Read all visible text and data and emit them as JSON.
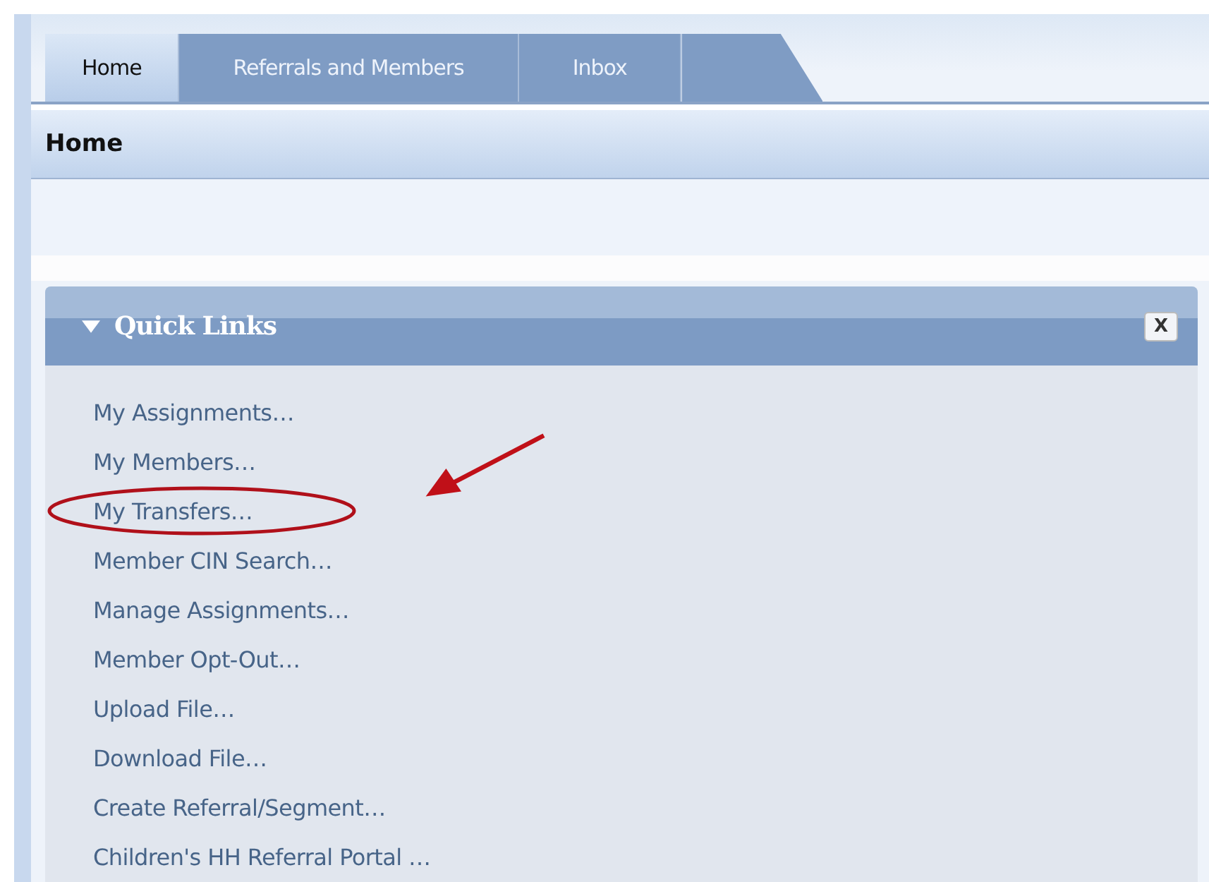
{
  "tabs": [
    {
      "label": "Home",
      "selected": true
    },
    {
      "label": "Referrals and Members",
      "selected": false
    },
    {
      "label": "Inbox",
      "selected": false
    }
  ],
  "page_title": "Home",
  "quick_links": {
    "title": "Quick Links",
    "expanded": true,
    "close_label": "X",
    "items": [
      {
        "label": "My Assignments…",
        "circled": false
      },
      {
        "label": "My Members…",
        "circled": false
      },
      {
        "label": "My Transfers…",
        "circled": true
      },
      {
        "label": "Member CIN Search…",
        "circled": false
      },
      {
        "label": "Manage Assignments…",
        "circled": false
      },
      {
        "label": "Member Opt-Out…",
        "circled": false
      },
      {
        "label": "Upload File…",
        "circled": false
      },
      {
        "label": "Download File…",
        "circled": false
      },
      {
        "label": "Create Referral/Segment…",
        "circled": false
      },
      {
        "label": "Children's HH Referral Portal …",
        "circled": false
      }
    ]
  }
}
